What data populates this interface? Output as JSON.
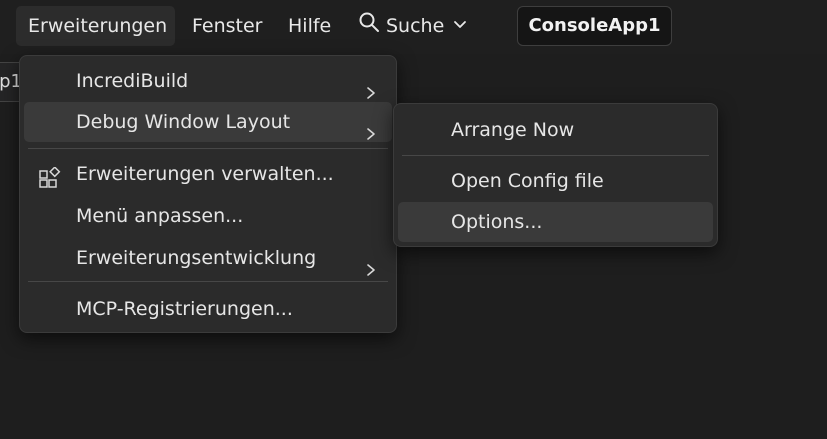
{
  "menubar": {
    "items": [
      {
        "label": "Erweiterungen"
      },
      {
        "label": "Fenster"
      },
      {
        "label": "Hilfe"
      }
    ],
    "search_label": "Suche",
    "project_name": "ConsoleApp1"
  },
  "left_tab_fragment": "p1",
  "extensions_menu": {
    "items": [
      {
        "label": "IncrediBuild"
      },
      {
        "label": "Debug Window Layout"
      },
      {
        "label": "Erweiterungen verwalten..."
      },
      {
        "label": "Menü anpassen..."
      },
      {
        "label": "Erweiterungsentwicklung"
      },
      {
        "label": "MCP-Registrierungen..."
      }
    ]
  },
  "debug_layout_submenu": {
    "items": [
      {
        "label": "Arrange Now"
      },
      {
        "label": "Open Config file"
      },
      {
        "label": "Options..."
      }
    ]
  },
  "colors": {
    "background": "#1e1e1e",
    "menu_background": "#2b2b2b",
    "hover": "#3a3a3a",
    "text": "#e6e6e6"
  }
}
